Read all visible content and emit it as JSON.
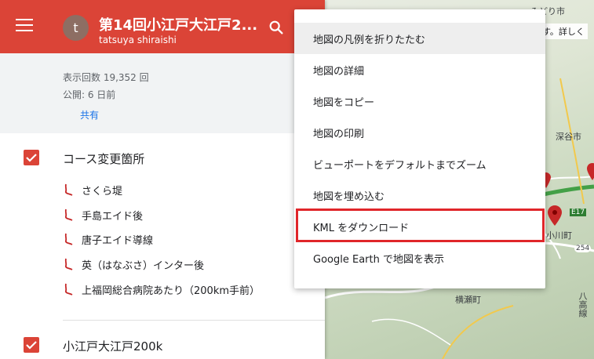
{
  "header": {
    "menu_icon": "hamburger-menu-icon",
    "avatar_letter": "t",
    "title": "第14回小江戸大江戸2...",
    "owner": "tatsuya shiraishi",
    "search_icon": "search-icon",
    "color": "#db4437"
  },
  "stats": {
    "views": "表示回数 19,352 回",
    "published": "公開: 6 日前",
    "share": "共有"
  },
  "layers": [
    {
      "title": "コース変更箇所",
      "items": [
        "さくら堤",
        "手島エイド後",
        "唐子エイド導線",
        "英（はなぶさ）インター後",
        "上福岡総合病院あたり（200km手前）"
      ]
    },
    {
      "title": "小江戸大江戸200k",
      "items": []
    }
  ],
  "dropdown": {
    "items": [
      "地図の凡例を折りたたむ",
      "地図の詳細",
      "地図をコピー",
      "地図の印刷",
      "ビューポートをデフォルトまでズーム",
      "地図を埋め込む",
      "KML をダウンロード",
      "Google Earth で地図を表示"
    ],
    "active_index": 0,
    "highlighted_index": 6,
    "highlight_color": "#e0262a"
  },
  "map": {
    "labels": [
      "みどり市",
      "深谷市",
      "横瀬町",
      "小川町",
      "八高線"
    ],
    "notice": "ます。詳しく",
    "route_badges": [
      "E17",
      "254"
    ]
  }
}
